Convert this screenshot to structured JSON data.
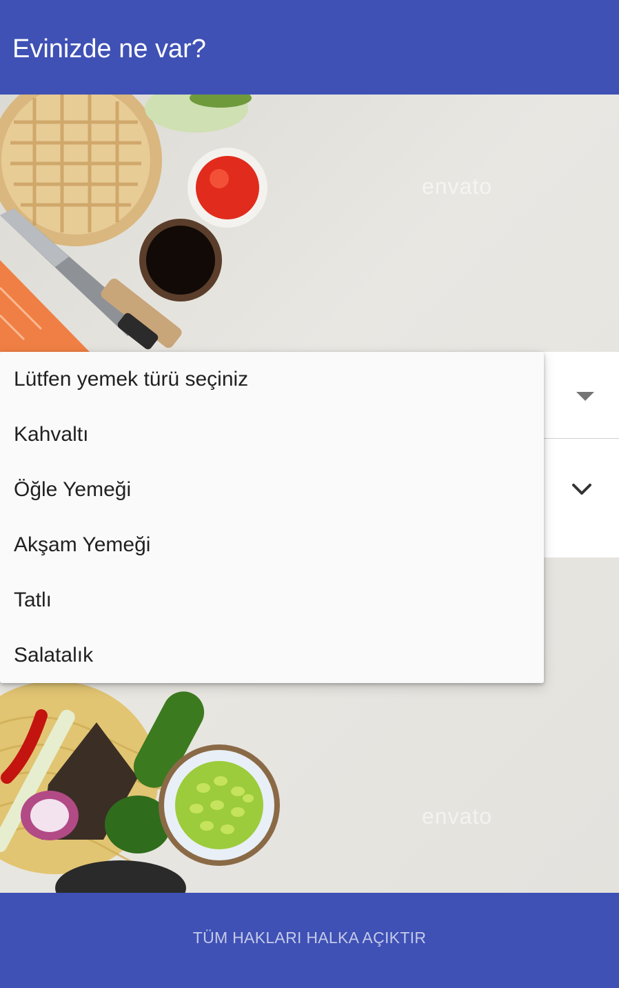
{
  "app_bar": {
    "title": "Evinizde ne var?"
  },
  "background": {
    "watermark": "envato"
  },
  "dropdown": {
    "items": [
      "Lütfen yemek türü seçiniz",
      "Kahvaltı",
      "Öğle Yemeği",
      "Akşam Yemeği",
      "Tatlı",
      "Salatalık"
    ]
  },
  "icons": {
    "spinner_arrow": "dropdown-arrow-icon",
    "expand": "chevron-down-icon"
  },
  "footer": {
    "text": "TÜM HAKLARI HALKA AÇIKTIR"
  },
  "colors": {
    "primary": "#3f51b5",
    "footer_text": "#c5cae9",
    "menu_bg": "#fafafa"
  }
}
